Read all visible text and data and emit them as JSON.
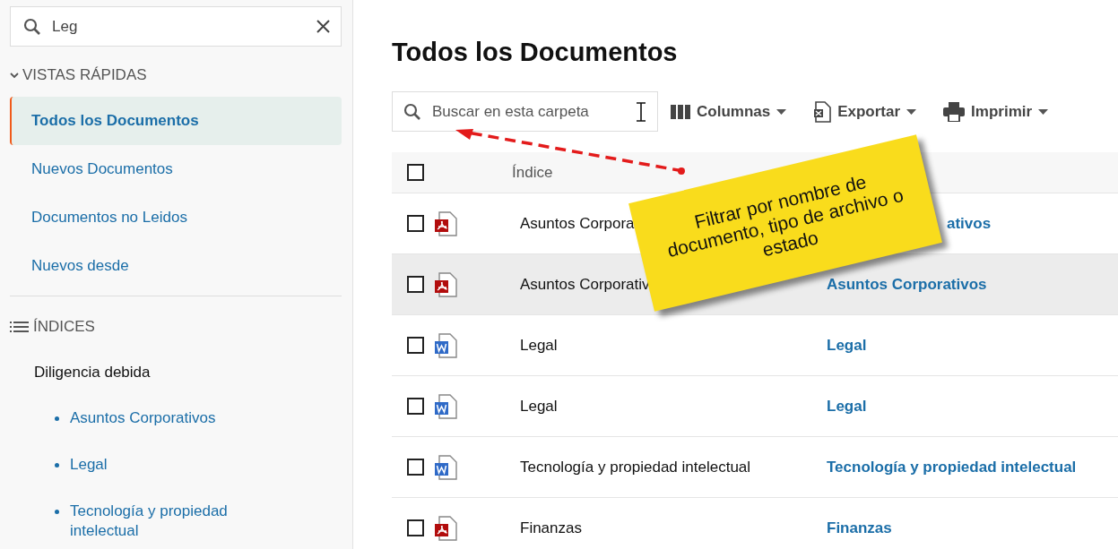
{
  "sidebar": {
    "search": {
      "value": "Leg"
    },
    "quick_views": {
      "title": "VISTAS RÁPIDAS",
      "expanded": true,
      "items": [
        {
          "label": "Todos los Documentos",
          "selected": true
        },
        {
          "label": "Nuevos Documentos",
          "selected": false
        },
        {
          "label": "Documentos no Leidos",
          "selected": false
        },
        {
          "label": "Nuevos desde",
          "selected": false
        }
      ]
    },
    "indexes": {
      "title": "ÍNDICES",
      "items": [
        {
          "label": "Diligencia debida",
          "children": [
            {
              "label": "Asuntos Corporativos"
            },
            {
              "label": "Legal"
            },
            {
              "label": "Tecnología y propiedad intelectual"
            }
          ]
        }
      ]
    }
  },
  "main": {
    "title": "Todos los Documentos",
    "search": {
      "placeholder": "Buscar en esta carpeta"
    },
    "toolbar": [
      {
        "kind": "columns",
        "label": "Columnas"
      },
      {
        "kind": "export",
        "label": "Exportar"
      },
      {
        "kind": "print",
        "label": "Imprimir"
      }
    ],
    "table": {
      "select_all": {
        "checked": false
      },
      "columns": [
        "Índice"
      ],
      "rows": [
        {
          "checked": false,
          "kind": "pdf",
          "name": "Asuntos Corpora",
          "index": "ativos",
          "index_covered": true,
          "highlighted": false
        },
        {
          "checked": false,
          "kind": "pdf",
          "name": "Asuntos Corporativ",
          "index": "Asuntos Corporativos",
          "index_covered": false,
          "highlighted": true
        },
        {
          "checked": false,
          "kind": "word",
          "name": "Legal",
          "index": "Legal",
          "index_covered": false,
          "highlighted": false
        },
        {
          "checked": false,
          "kind": "word",
          "name": "Legal",
          "index": "Legal",
          "index_covered": false,
          "highlighted": false
        },
        {
          "checked": false,
          "kind": "word",
          "name": "Tecnología y propiedad intelectual",
          "index": "Tecnología y propiedad intelectual",
          "index_covered": false,
          "highlighted": false
        },
        {
          "checked": false,
          "kind": "pdf",
          "name": "Finanzas",
          "index": "Finanzas",
          "index_covered": false,
          "highlighted": false
        }
      ]
    },
    "callout": {
      "text": "Filtrar por nombre de documento, tipo de archivo o estado"
    }
  }
}
